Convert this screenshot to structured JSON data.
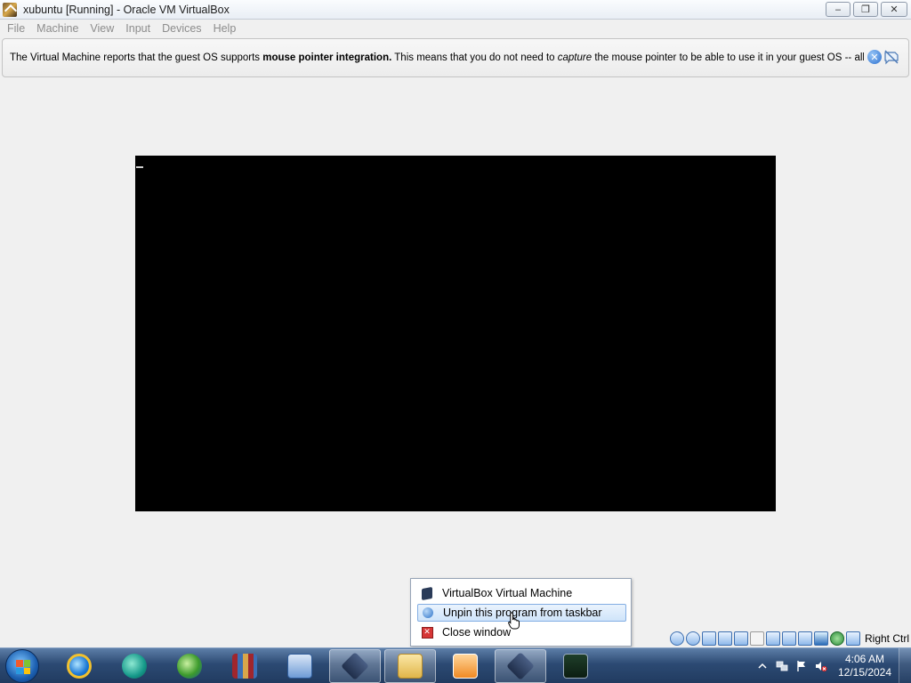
{
  "window": {
    "title": "xubuntu [Running] - Oracle VM VirtualBox",
    "minimize_label": "‒",
    "restore_label": "❐",
    "close_label": "✕"
  },
  "menu": {
    "items": [
      {
        "label": "File"
      },
      {
        "label": "Machine"
      },
      {
        "label": "View"
      },
      {
        "label": "Input"
      },
      {
        "label": "Devices"
      },
      {
        "label": "Help"
      }
    ]
  },
  "notification": {
    "text_before": "The Virtual Machine reports that the guest OS supports ",
    "bold": "mouse pointer integration.",
    "text_middle": " This means that you do not need to ",
    "italic": "capture",
    "text_after": " the mouse pointer to be able to use it in your guest OS -- all mouse",
    "close_glyph": "✕"
  },
  "status_bar": {
    "host_key_label": "Right Ctrl",
    "icons": [
      "hard-disk-icon",
      "optical-drive-icon",
      "audio-icon",
      "network-icon",
      "usb-icon",
      "shared-folders-icon",
      "display-icon",
      "video-capture-icon",
      "recording-icon",
      "virtualization-icon",
      "mouse-integration-icon",
      "keyboard-capture-icon"
    ]
  },
  "jump_list": {
    "items": [
      {
        "label": "VirtualBox Virtual Machine",
        "icon": "virtualbox-icon",
        "highlighted": false
      },
      {
        "label": "Unpin this program from taskbar",
        "icon": "unpin-icon",
        "highlighted": true
      },
      {
        "label": "Close window",
        "icon": "close-window-icon",
        "highlighted": false
      }
    ]
  },
  "taskbar": {
    "buttons": [
      {
        "name": "internet-explorer-icon",
        "active": false
      },
      {
        "name": "media-player-icon",
        "active": false
      },
      {
        "name": "download-manager-icon",
        "active": false
      },
      {
        "name": "winrar-icon",
        "active": false
      },
      {
        "name": "network-setup-icon",
        "active": false
      },
      {
        "name": "virtualbox-manager-icon",
        "active": true
      },
      {
        "name": "file-explorer-icon",
        "active": true
      },
      {
        "name": "media-center-icon",
        "active": false
      },
      {
        "name": "virtualbox-vm-icon",
        "active": true
      },
      {
        "name": "task-manager-icon",
        "active": false
      }
    ],
    "clock_time": "4:06 AM",
    "clock_date": "12/15/2024"
  }
}
